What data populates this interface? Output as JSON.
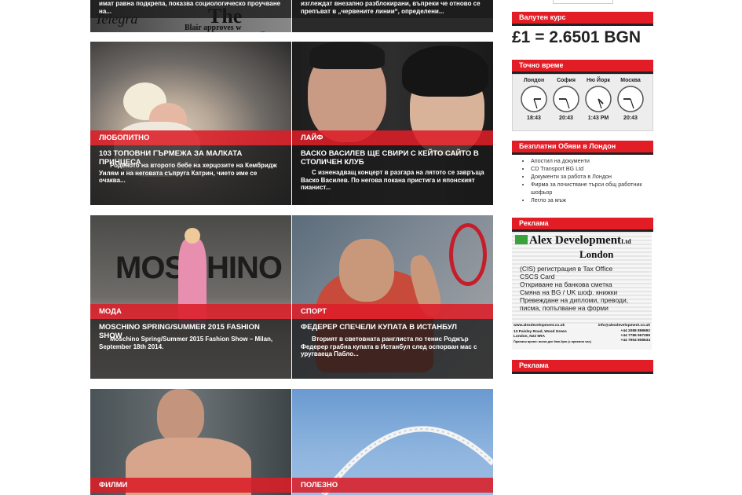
{
  "top_row": {
    "left_excerpt": "имат равна подкрепа, показва социологическо проучване на...",
    "right_excerpt": "изглеждат внезапно разблокирани, въпреки че отново се препъват в „червените линии“, определени...",
    "newspaper_text_1": "The Guard",
    "newspaper_text_2": "Blair approves w",
    "newspaper_text_3": "Telegra"
  },
  "cards": [
    {
      "category": "ЛЮБОПИТНО",
      "title": "103 ТОПОВНИ ГЪРМЕЖА ЗА МАЛКАТА ПРИНЦЕСА",
      "excerpt": "Роденото на второто бебе на херцозите на Кембридж Уилям и на неговата съпруга Катрин, чието име се очаква..."
    },
    {
      "category": "ЛАЙФ",
      "title": "ВАСКО ВАСИЛЕВ ЩЕ СВИРИ С КЕЙТО САЙТО В СТОЛИЧЕН КЛУБ",
      "excerpt": "С изненадващ концерт в разгара на лятото се завръща Васко Василев. По негова покана пристига и японският пианист..."
    },
    {
      "category": "МОДА",
      "title": "MOSCHINO SPRING/SUMMER 2015 FASHION SHOW",
      "excerpt": "Moschino Spring/Summer 2015 Fashion Show – Milan, September 18th 2014.",
      "image_text": "MOSCHINO"
    },
    {
      "category": "СПОРТ",
      "title": "ФЕДЕРЕР СПЕЧЕЛИ КУПАТА В ИСТАНБУЛ",
      "excerpt": "Вторият в световната ранглиста по тенис Роджър Федерер грабна купата в Истанбул след оспорван мас с уругваеца Пабло..."
    },
    {
      "category": "ФИЛМИ"
    },
    {
      "category": "ПОЛЕЗНО"
    }
  ],
  "sidebar": {
    "currency": {
      "heading": "Валутен курс",
      "rate": "£1 = 2.6501 BGN"
    },
    "time": {
      "heading": "Точно време",
      "clocks": [
        {
          "city": "Лондон",
          "time": "18:43"
        },
        {
          "city": "София",
          "time": "20:43"
        },
        {
          "city": "Ню Йорк",
          "time": "1:43 PM"
        },
        {
          "city": "Москва",
          "time": "20:43"
        }
      ]
    },
    "ads": {
      "heading": "Безплатни Обяви в Лондон",
      "items": [
        "Апостил на документи",
        "CD Transport BG Ltd",
        "Документи за работа в Лондон",
        "Фирма за почистване търси общ работник шофьор",
        "Легло за мъж"
      ]
    },
    "promo": {
      "heading": "Реклама",
      "brand": "Alex Development",
      "brand_suffix": "Ltd",
      "city": "London",
      "lines": [
        "(CIS) регистрация в Tax Office",
        "CSCS Card",
        "Откриване на банкова сметка",
        "Смяна на BG / UK шоф. книжки",
        "Превеждане на дипломи, преводи, писма, попълване на форми"
      ],
      "website": "www.alexdevelopment.co.uk",
      "email": "info@alexdevelopment.co.uk",
      "address": "13 Paisley Road, Wood Green London, N22 5RA",
      "phones": [
        "+44 2088 898692",
        "+44 7786 967299",
        "+44 7954 808634"
      ],
      "hours": "Приемно време: всеки ден 9am-9pm (с приемно час)"
    },
    "promo2": {
      "heading": "Реклама"
    }
  }
}
